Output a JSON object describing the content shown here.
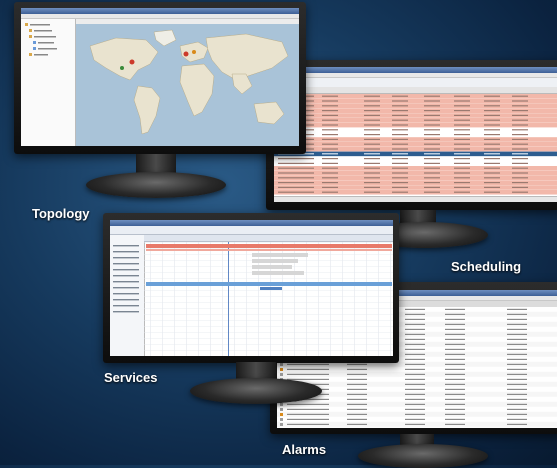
{
  "labels": {
    "topology": "Topology",
    "scheduling": "Scheduling",
    "services": "Services",
    "alarms": "Alarms"
  },
  "colors": {
    "background": "#163a5e",
    "alarm_row": "#f2b8aa",
    "selected_row": "#2d5d8f",
    "gantt_bar_red": "#e87a6a",
    "gantt_bar_blue": "#6aa0d8"
  }
}
